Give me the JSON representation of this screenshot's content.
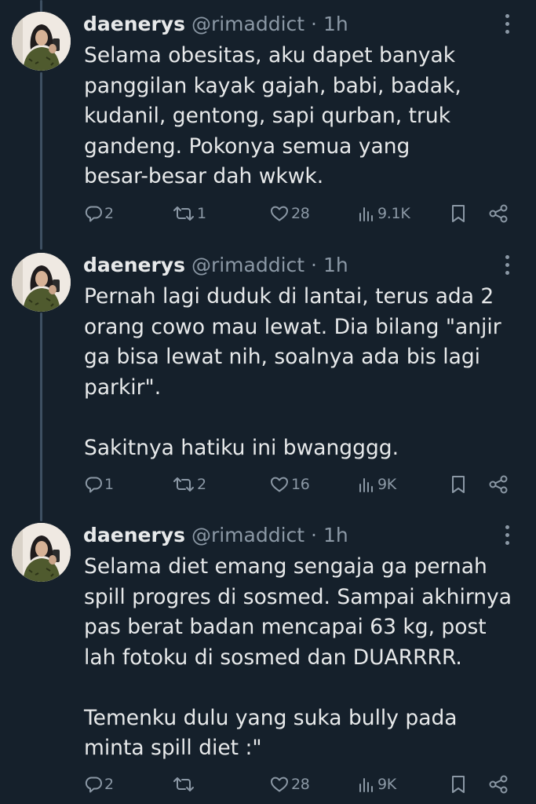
{
  "tweets": [
    {
      "name": "daenerys",
      "handle": "@rimaddict",
      "separator": "·",
      "time": "1h",
      "text": "Selama obesitas, aku dapet banyak\npanggilan kayak gajah, babi, badak,\nkudanil, gentong, sapi qurban, truk\ngandeng. Pokonya semua yang\nbesar-besar dah wkwk.",
      "replies": "2",
      "reposts": "1",
      "likes": "28",
      "views": "9.1K"
    },
    {
      "name": "daenerys",
      "handle": "@rimaddict",
      "separator": "·",
      "time": "1h",
      "text": "Pernah lagi duduk di lantai, terus ada 2\norang cowo mau lewat. Dia bilang \"anjir\nga bisa lewat nih, soalnya ada bis lagi\nparkir\".\n\nSakitnya hatiku ini bwangggg.",
      "replies": "1",
      "reposts": "2",
      "likes": "16",
      "views": "9K"
    },
    {
      "name": "daenerys",
      "handle": "@rimaddict",
      "separator": "·",
      "time": "1h",
      "text": "Selama diet emang sengaja ga pernah\nspill progres di sosmed. Sampai akhirnya\npas berat badan mencapai 63 kg, post\nlah fotoku di sosmed dan DUARRRR.\n\nTemenku dulu yang suka bully pada\nminta spill diet :\"",
      "replies": "2",
      "reposts": "",
      "likes": "28",
      "views": "9K"
    }
  ],
  "icons": {
    "reply": "reply-icon",
    "repost": "repost-icon",
    "like": "heart-icon",
    "views": "views-icon",
    "bookmark": "bookmark-icon",
    "share": "share-icon",
    "more": "more-icon"
  },
  "colors": {
    "background": "#15202b",
    "primary_text": "#e7e9ea",
    "secondary_text": "#8b98a5",
    "thread_line": "#3e5062"
  }
}
